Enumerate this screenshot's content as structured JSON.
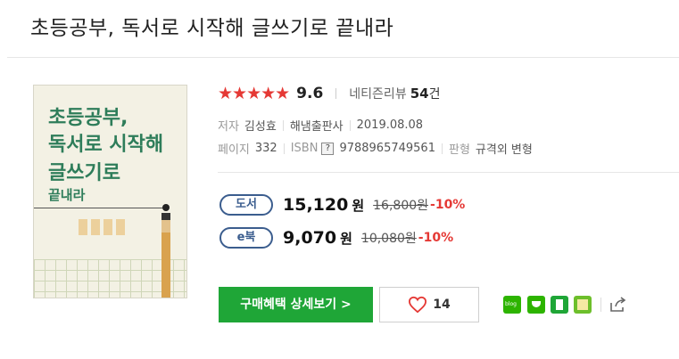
{
  "title": "초등공부, 독서로 시작해 글쓰기로 끝내라",
  "cover": {
    "line1": "초등공부,",
    "line2": "독서로 시작해",
    "line3": "글쓰기로",
    "line4": "끝내라"
  },
  "rating": {
    "stars": "★★★★★",
    "score": "9.6",
    "review_label": "네티즌리뷰",
    "review_count": "54",
    "review_unit": "건"
  },
  "meta": {
    "author_label": "저자",
    "author": "김성효",
    "publisher": "해냄출판사",
    "date": "2019.08.08",
    "pages_label": "페이지",
    "pages": "332",
    "isbn_label": "ISBN",
    "isbn_help": "?",
    "isbn": "9788965749561",
    "format_label": "판형",
    "format": "규격외 변형"
  },
  "prices": [
    {
      "label": "도서",
      "price": "15,120",
      "unit": "원",
      "original": "16,800원",
      "discount": "-10%"
    },
    {
      "label": "e북",
      "price": "9,070",
      "unit": "원",
      "original": "10,080원",
      "discount": "-10%"
    }
  ],
  "buttons": {
    "buy_label": "구매혜택 상세보기 >",
    "like_count": "14"
  },
  "colors": {
    "accent_green": "#1fa637",
    "star_red": "#e53935",
    "pill_blue": "#3b5d8e"
  },
  "icons": [
    "heart-icon",
    "naver-blog-icon",
    "naver-cafe-icon",
    "band-icon",
    "memo-icon",
    "share-icon"
  ]
}
